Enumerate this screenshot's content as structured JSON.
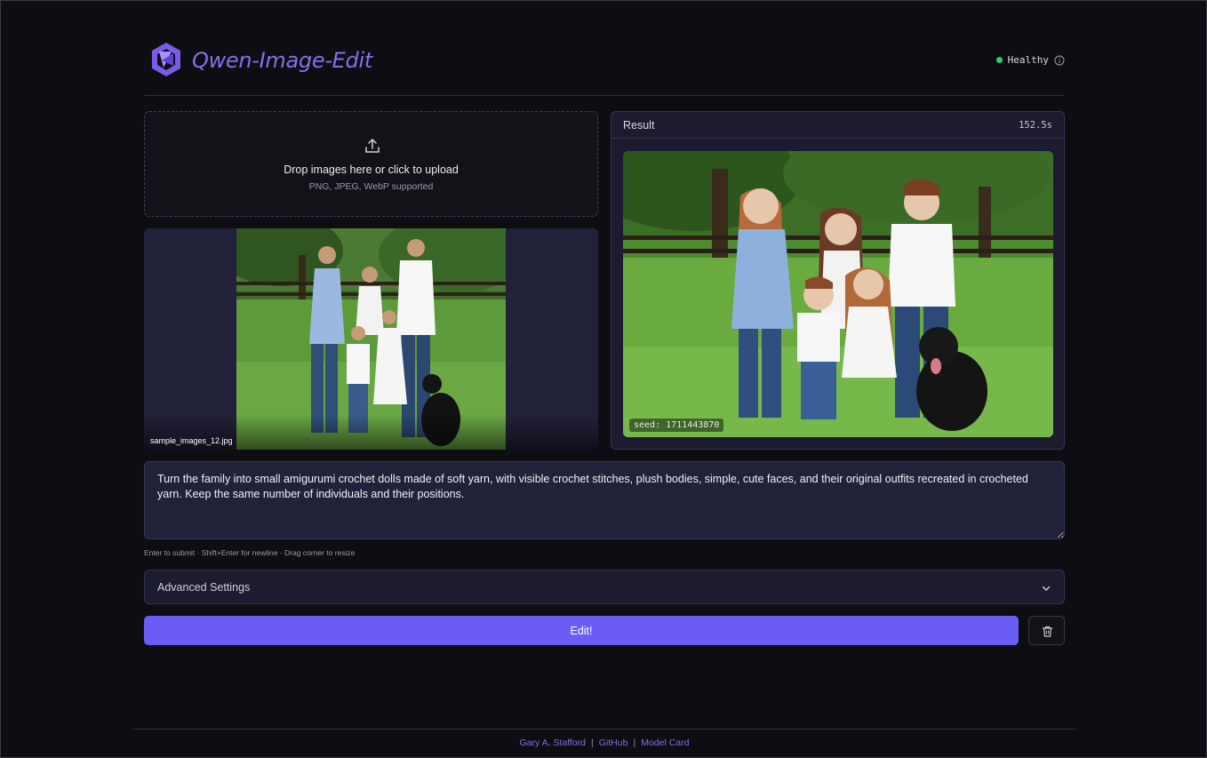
{
  "app": {
    "title": "Qwen-Image-Edit",
    "status": "Healthy",
    "brand_color": "#8a6cf0",
    "status_color": "#2bd26b"
  },
  "upload": {
    "title": "Drop images here or click to upload",
    "subtitle": "PNG, JPEG, WebP supported",
    "icon": "upload-icon"
  },
  "input_image": {
    "filename": "sample_images_12.jpg"
  },
  "result": {
    "label": "Result",
    "time": "152.5s",
    "seed": "seed: 1711443870"
  },
  "prompt": {
    "value": "Turn the family into small amigurumi crochet dolls made of soft yarn, with visible crochet stitches, plush bodies, simple, cute faces, and their original outfits recreated in crocheted yarn. Keep the same number of individuals and their positions.",
    "hint": "Enter to submit · Shift+Enter for newline · Drag corner to resize"
  },
  "advanced": {
    "label": "Advanced Settings"
  },
  "actions": {
    "edit_label": "Edit!",
    "accent": "#6b5cf6"
  },
  "footer": {
    "links": [
      "Gary A. Stafford",
      "GitHub",
      "Model Card"
    ],
    "separator": "|"
  }
}
